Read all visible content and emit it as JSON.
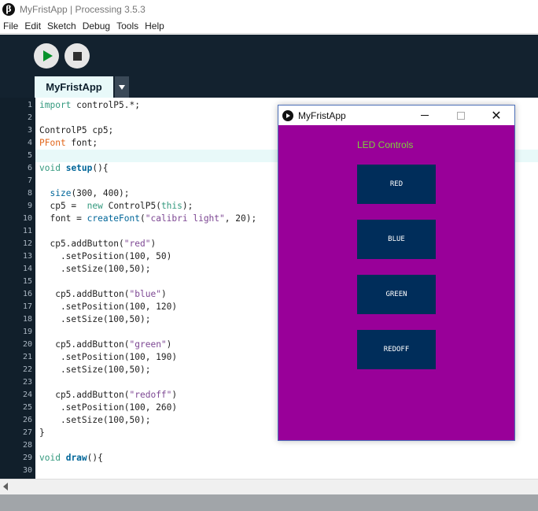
{
  "window": {
    "title": "MyFristApp | Processing 3.5.3",
    "logo_glyph": "β"
  },
  "menubar": [
    "File",
    "Edit",
    "Sketch",
    "Debug",
    "Tools",
    "Help"
  ],
  "toolbar": {
    "run_icon": "play-icon",
    "stop_icon": "stop-icon"
  },
  "tabs": [
    {
      "label": "MyFristApp"
    }
  ],
  "editor": {
    "current_line": 5,
    "lines": [
      "1",
      "2",
      "3",
      "4",
      "5",
      "6",
      "7",
      "8",
      "9",
      "10",
      "11",
      "12",
      "13",
      "14",
      "15",
      "16",
      "17",
      "18",
      "19",
      "20",
      "21",
      "22",
      "23",
      "24",
      "25",
      "26",
      "27",
      "28",
      "29",
      "30"
    ],
    "code": [
      [
        {
          "t": "kw",
          "v": "import"
        },
        {
          "t": "",
          "v": " controlP5.*;"
        }
      ],
      [],
      [
        {
          "t": "",
          "v": "ControlP5 cp5;"
        }
      ],
      [
        {
          "t": "type",
          "v": "PFont"
        },
        {
          "t": "",
          "v": " font;"
        }
      ],
      [],
      [
        {
          "t": "kw",
          "v": "void"
        },
        {
          "t": "",
          "v": " "
        },
        {
          "t": "fnb",
          "v": "setup"
        },
        {
          "t": "",
          "v": "(){"
        }
      ],
      [],
      [
        {
          "t": "",
          "v": "  "
        },
        {
          "t": "fn",
          "v": "size"
        },
        {
          "t": "",
          "v": "(300, 400);"
        }
      ],
      [
        {
          "t": "",
          "v": "  cp5 =  "
        },
        {
          "t": "kw",
          "v": "new"
        },
        {
          "t": "",
          "v": " ControlP5("
        },
        {
          "t": "this",
          "v": "this"
        },
        {
          "t": "",
          "v": ");"
        }
      ],
      [
        {
          "t": "",
          "v": "  font = "
        },
        {
          "t": "fn",
          "v": "createFont"
        },
        {
          "t": "",
          "v": "("
        },
        {
          "t": "str",
          "v": "\"calibri light\""
        },
        {
          "t": "",
          "v": ", 20);"
        }
      ],
      [],
      [
        {
          "t": "",
          "v": "  cp5.addButton("
        },
        {
          "t": "str",
          "v": "\"red\""
        },
        {
          "t": "",
          "v": ")"
        }
      ],
      [
        {
          "t": "",
          "v": "    .setPosition(100, 50)"
        }
      ],
      [
        {
          "t": "",
          "v": "    .setSize(100,50);"
        }
      ],
      [],
      [
        {
          "t": "",
          "v": "   cp5.addButton("
        },
        {
          "t": "str",
          "v": "\"blue\""
        },
        {
          "t": "",
          "v": ")"
        }
      ],
      [
        {
          "t": "",
          "v": "    .setPosition(100, 120)"
        }
      ],
      [
        {
          "t": "",
          "v": "    .setSize(100,50);"
        }
      ],
      [],
      [
        {
          "t": "",
          "v": "   cp5.addButton("
        },
        {
          "t": "str",
          "v": "\"green\""
        },
        {
          "t": "",
          "v": ")"
        }
      ],
      [
        {
          "t": "",
          "v": "    .setPosition(100, 190)"
        }
      ],
      [
        {
          "t": "",
          "v": "    .setSize(100,50);"
        }
      ],
      [],
      [
        {
          "t": "",
          "v": "   cp5.addButton("
        },
        {
          "t": "str",
          "v": "\"redoff\""
        },
        {
          "t": "",
          "v": ")"
        }
      ],
      [
        {
          "t": "",
          "v": "    .setPosition(100, 260)"
        }
      ],
      [
        {
          "t": "",
          "v": "    .setSize(100,50);"
        }
      ],
      [
        {
          "t": "",
          "v": "}"
        }
      ],
      [],
      [
        {
          "t": "kw",
          "v": "void"
        },
        {
          "t": "",
          "v": " "
        },
        {
          "t": "fnb",
          "v": "draw"
        },
        {
          "t": "",
          "v": "(){"
        }
      ],
      []
    ]
  },
  "sketch_window": {
    "title": "MyFristApp",
    "close_glyph": "✕",
    "canvas_color": "#990099",
    "label": "LED Controls",
    "buttons": [
      "RED",
      "BLUE",
      "GREEN",
      "REDOFF"
    ],
    "button_color": "#002d5a"
  },
  "colors": {
    "toolbar_bg": "#13222f",
    "run_green": "#06912a"
  }
}
